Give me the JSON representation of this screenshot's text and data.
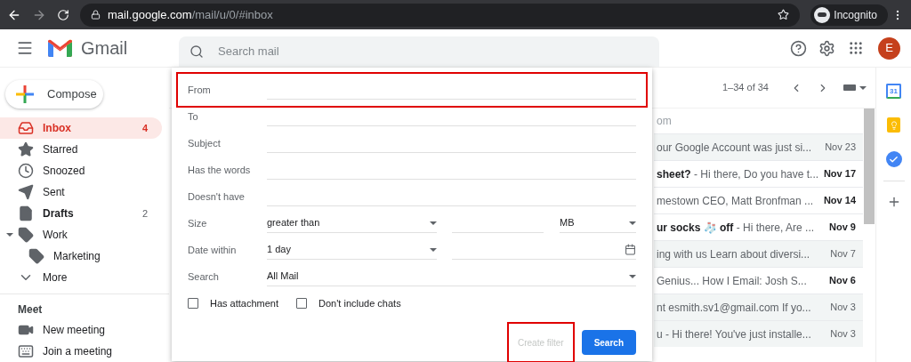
{
  "browser": {
    "url_host": "mail.google.com",
    "url_path": "/mail/u/0/#inbox",
    "profile": "Incognito"
  },
  "header": {
    "app_name": "Gmail",
    "search_placeholder": "Search mail",
    "avatar": "E"
  },
  "sidebar": {
    "compose": "Compose",
    "items": [
      {
        "kind": "inbox",
        "label": "Inbox",
        "count": "4",
        "selected": true,
        "bold": true
      },
      {
        "kind": "star",
        "label": "Starred",
        "selected": false,
        "bold": false
      },
      {
        "kind": "clock",
        "label": "Snoozed",
        "selected": false,
        "bold": false
      },
      {
        "kind": "send",
        "label": "Sent",
        "selected": false,
        "bold": false
      },
      {
        "kind": "draft",
        "label": "Drafts",
        "count": "2",
        "selected": false,
        "bold": true
      },
      {
        "kind": "label",
        "label": "Work",
        "selected": false,
        "bold": false,
        "expanded": true,
        "children": [
          {
            "kind": "label",
            "label": "Marketing",
            "selected": false,
            "bold": false
          }
        ]
      },
      {
        "kind": "more",
        "label": "More",
        "selected": false,
        "bold": false
      }
    ],
    "meet": {
      "title": "Meet",
      "items": [
        {
          "kind": "video",
          "label": "New meeting"
        },
        {
          "kind": "keyboard",
          "label": "Join a meeting"
        }
      ]
    }
  },
  "toolbar": {
    "range": "1–34 of 34"
  },
  "list_header": "om",
  "emails": [
    {
      "snippet": "our Google Account was just si...",
      "date": "Nov 23",
      "unread": false
    },
    {
      "snippet": "**sheet?** - Hi there, Do you have t...",
      "date": "Nov 17",
      "unread": true
    },
    {
      "snippet": "mestown CEO, Matt Bronfman ...",
      "date": "Nov 14",
      "unread": true
    },
    {
      "snippet": "**ur socks 🧦 off** - Hi there, Are ...",
      "date": "Nov 9",
      "unread": true
    },
    {
      "snippet": "ing with us Learn about diversi...",
      "date": "Nov 7",
      "unread": false
    },
    {
      "snippet": "Genius... How I Email: Josh S...",
      "date": "Nov 6",
      "unread": true
    },
    {
      "snippet": "nt esmith.sv1@gmail.com If yo...",
      "date": "Nov 3",
      "unread": false
    },
    {
      "snippet": "u - Hi there! You've just installe...",
      "date": "Nov 3",
      "unread": false
    }
  ],
  "side_panel": {
    "calendar_day": "31"
  },
  "filter": {
    "fields": [
      {
        "label": "From",
        "highlighted": true
      },
      {
        "label": "To",
        "highlighted": false
      },
      {
        "label": "Subject",
        "highlighted": false
      },
      {
        "label": "Has the words",
        "highlighted": false
      },
      {
        "label": "Doesn't have",
        "highlighted": false
      }
    ],
    "size": {
      "label": "Size",
      "comparator": "greater than",
      "unit": "MB"
    },
    "date": {
      "label": "Date within",
      "value": "1 day"
    },
    "search": {
      "label": "Search",
      "value": "All Mail"
    },
    "checkboxes": [
      {
        "label": "Has attachment",
        "checked": false
      },
      {
        "label": "Don't include chats",
        "checked": false
      }
    ],
    "buttons": [
      {
        "kind": "text",
        "label": "Create filter",
        "disabled": true,
        "highlighted": true
      },
      {
        "kind": "primary",
        "label": "Search",
        "disabled": false,
        "highlighted": false
      }
    ]
  }
}
